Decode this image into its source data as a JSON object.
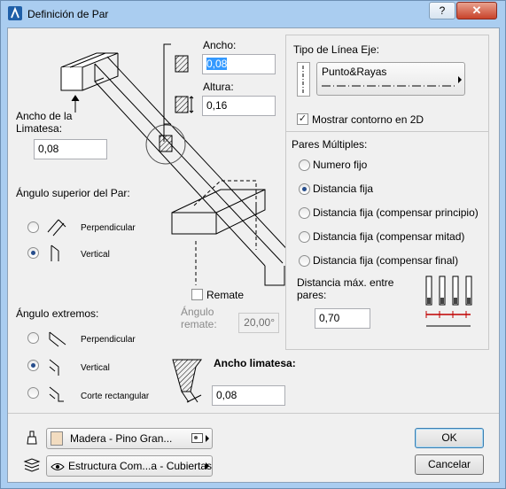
{
  "window": {
    "title": "Definición de Par",
    "help_label": "?",
    "close_label": "✕"
  },
  "left": {
    "ancho_label": "Ancho:",
    "ancho_value": "0,08",
    "altura_label": "Altura:",
    "altura_value": "0,16",
    "ancho_limatesa_label": "Ancho de la Limatesa:",
    "ancho_limatesa_value": "0,08",
    "angulo_superior_label": "Ángulo superior del Par:",
    "superior_options": [
      {
        "label": "Perpendicular",
        "selected": false
      },
      {
        "label": "Vertical",
        "selected": true
      }
    ],
    "remate_label": "Remate",
    "remate_checked": false,
    "angulo_remate_label": "Ángulo remate:",
    "angulo_remate_value": "20,00°",
    "angulo_extremos_label": "Ángulo extremos:",
    "extremos_options": [
      {
        "label": "Perpendicular",
        "selected": false
      },
      {
        "label": "Vertical",
        "selected": true
      },
      {
        "label": "Corte rectangular",
        "selected": false
      }
    ],
    "ancho_limatesa2_label": "Ancho limatesa:",
    "ancho_limatesa2_value": "0,08"
  },
  "right": {
    "tipo_linea_label": "Tipo de Línea Eje:",
    "tipo_linea_value": "Punto&Rayas",
    "mostrar_contorno_label": "Mostrar contorno en 2D",
    "mostrar_contorno_checked": true,
    "pares_multiples_label": "Pares Múltiples:",
    "pares_options": [
      {
        "label": "Numero fijo",
        "selected": false
      },
      {
        "label": "Distancia fija",
        "selected": true
      },
      {
        "label": "Distancia fija (compensar principio)",
        "selected": false
      },
      {
        "label": "Distancia fija (compensar mitad)",
        "selected": false
      },
      {
        "label": "Distancia fija (compensar final)",
        "selected": false
      }
    ],
    "distancia_max_label": "Distancia máx. entre pares:",
    "distancia_max_value": "0,70"
  },
  "bottom": {
    "material_value": "Madera - Pino Gran...",
    "material_color": "#f2dcc0",
    "layer_value": "Estructura Com...a - Cubiertas",
    "ok_label": "OK",
    "cancel_label": "Cancelar"
  },
  "colors": {
    "title_bar": "#aacdf0",
    "dialog_bg": "#f0f0f0",
    "selection": "#3399ff",
    "close_button": "#c8432b",
    "dimension_red": "#c00000"
  },
  "icons": {
    "app": "archicad-icon",
    "material": "brush-icon",
    "layer": "layers-icon",
    "visibility": "eye-icon"
  }
}
